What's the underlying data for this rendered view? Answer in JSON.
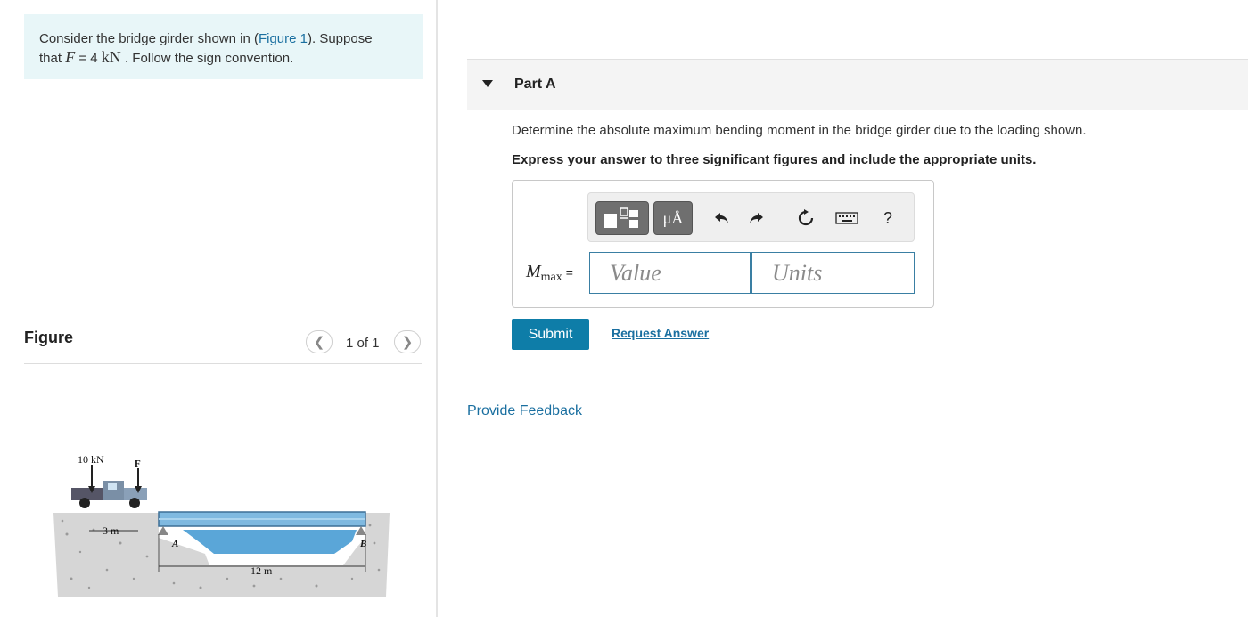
{
  "problem": {
    "text_before_link": "Consider the bridge girder shown in (",
    "link_text": "Figure 1",
    "text_after_link": "). Suppose",
    "line2_prefix": "that ",
    "var_F": "F",
    "equals": " = 4 ",
    "unit": "kN",
    "line2_suffix": " . Follow the sign convention."
  },
  "figure": {
    "title": "Figure",
    "pager": "1 of 1",
    "prev_icon": "chevron-left-icon",
    "next_icon": "chevron-right-icon",
    "labels": {
      "load": "10 kN",
      "force": "F",
      "spacing": "3 m",
      "span": "12 m",
      "support_a": "A",
      "support_b": "B"
    }
  },
  "part": {
    "title": "Part A",
    "question": "Determine the absolute maximum bending moment in the bridge girder due to the loading shown.",
    "instruction": "Express your answer to three significant figures and include the appropriate units."
  },
  "toolbar": {
    "templates_icon": "templates-icon",
    "units_label": "μÅ",
    "undo_icon": "undo-icon",
    "redo_icon": "redo-icon",
    "reset_icon": "reset-icon",
    "keyboard_icon": "keyboard-icon",
    "help_label": "?"
  },
  "answer": {
    "label_main": "M",
    "label_sub": "max",
    "label_eq": "=",
    "value_placeholder": "Value",
    "units_placeholder": "Units"
  },
  "actions": {
    "submit": "Submit",
    "request_answer": "Request Answer",
    "provide_feedback": "Provide Feedback"
  },
  "colors": {
    "problem_bg": "#e8f6f8",
    "link": "#1a6fa0",
    "submit_bg": "#0e7da8",
    "input_border": "#3a7fa3"
  }
}
